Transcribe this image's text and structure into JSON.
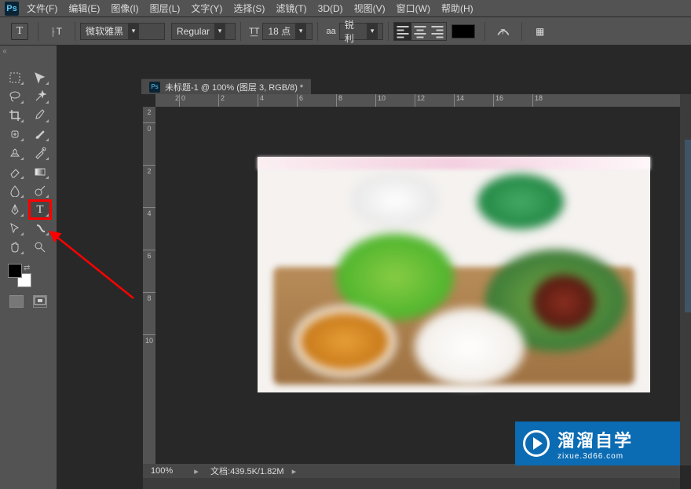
{
  "app": {
    "logo": "Ps"
  },
  "menu": {
    "file": "文件(F)",
    "edit": "编辑(E)",
    "image": "图像(I)",
    "layer": "图层(L)",
    "type": "文字(Y)",
    "select": "选择(S)",
    "filter": "滤镜(T)",
    "threeD": "3D(D)",
    "view": "视图(V)",
    "window": "窗口(W)",
    "help": "帮助(H)"
  },
  "options": {
    "tool_glyph": "T",
    "orient_glyph": "⸠T",
    "font": "微软雅黑",
    "font_style": "Regular",
    "size_glyph": "T͟T",
    "font_size": "18 点",
    "aa_glyph": "aa",
    "aa_mode": "锐利",
    "panel_icon": "▦"
  },
  "document": {
    "tab_title": "未标题-1 @ 100% (图层 3, RGB/8) *",
    "ruler_h": [
      "2",
      "0",
      "2",
      "4",
      "6",
      "8",
      "10",
      "12",
      "14",
      "16",
      "18"
    ],
    "ruler_v": [
      "2",
      "0",
      "2",
      "4",
      "6",
      "8",
      "10"
    ]
  },
  "status": {
    "zoom": "100%",
    "label": "文档:",
    "size": "439.5K/1.82M"
  },
  "watermark": {
    "title": "溜溜自学",
    "url": "zixue.3d66.com"
  }
}
